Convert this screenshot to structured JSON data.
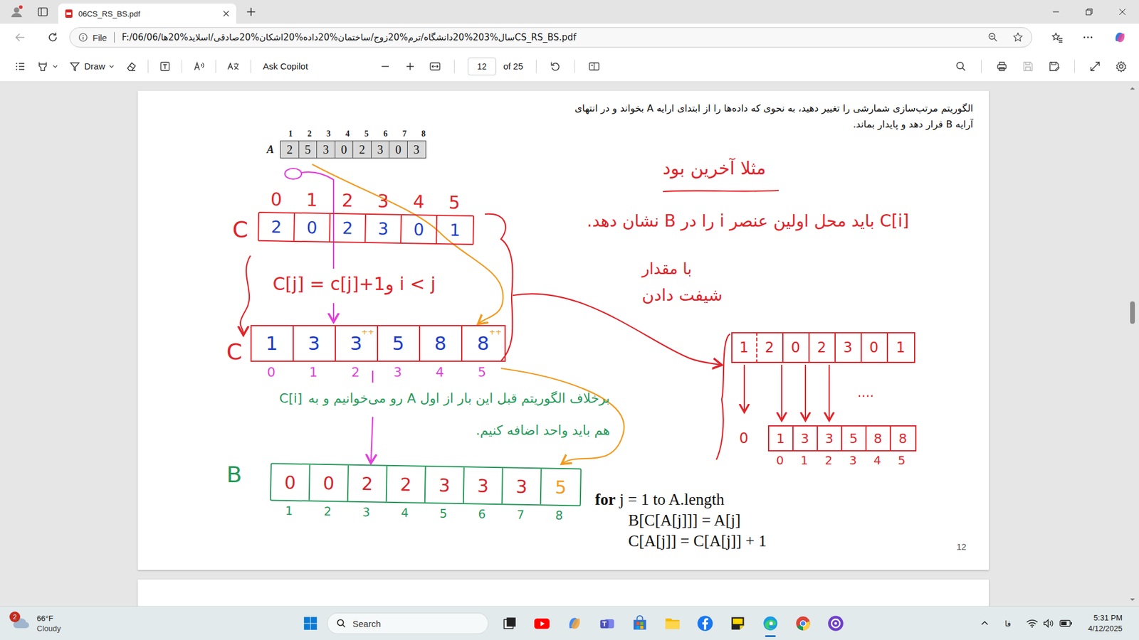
{
  "window": {
    "title": "06CS_RS_BS.pdf"
  },
  "tabs": [
    {
      "label": "06CS_RS_BS.pdf",
      "selected": true
    }
  ],
  "address": {
    "scheme": "File",
    "url": "F:/06/سال%203%20دانشگاه/ترم%20زوج/ساختمان%20داده%20اشکان%20صادقی/اسلاید%20ها/06CS_RS_BS.pdf"
  },
  "toolbar": {
    "draw": "Draw",
    "copilot": "Ask Copilot",
    "page": "12",
    "pages": "of 25"
  },
  "page": {
    "heading": [
      "الگوریتم مرتب‌سازی شمارشی را تغییر دهید، به نحوی که داده‌ها را از ابتدای ارایه A بخواند و در انتهای",
      "آرایه B قرار دهد و پایدار بماند."
    ],
    "arrayA": {
      "label": "A",
      "indices": [
        "1",
        "2",
        "3",
        "4",
        "5",
        "6",
        "7",
        "8"
      ],
      "values": [
        "2",
        "5",
        "3",
        "0",
        "2",
        "3",
        "0",
        "3"
      ]
    },
    "code": [
      {
        "keyword": "for",
        "text": "j  = 1 to A.length",
        "indent": false
      },
      {
        "text": "B[C[A[j]]] = A[j]",
        "indent": true
      },
      {
        "text": "C[A[j]] = C[A[j]] + 1",
        "indent": true
      }
    ],
    "number": "12"
  },
  "annotations": {
    "countArray": {
      "label": "C",
      "indices": [
        "0",
        "1",
        "2",
        "3",
        "4",
        "5"
      ],
      "values": [
        "2",
        "0",
        "2",
        "3",
        "0",
        "1"
      ]
    },
    "formula": "C[j] = c[j]+1و i < j",
    "positionArray": {
      "label": "C",
      "indices": [
        "0",
        "1",
        "2",
        "3",
        "4",
        "5"
      ],
      "values": [
        "1",
        "3",
        "3",
        "5",
        "8",
        "8"
      ],
      "marks": [
        "",
        "",
        "++",
        "",
        "",
        "++"
      ]
    },
    "outputArray": {
      "label": "B",
      "indices": [
        "1",
        "2",
        "3",
        "4",
        "5",
        "6",
        "7",
        "8"
      ],
      "values": [
        {
          "value": "0",
          "color": "#d8232a"
        },
        {
          "value": "0",
          "color": "#d8232a"
        },
        {
          "value": "2",
          "color": "#d8232a"
        },
        {
          "value": "2",
          "color": "#d8232a"
        },
        {
          "value": "3",
          "color": "#d8232a"
        },
        {
          "value": "3",
          "color": "#d8232a"
        },
        {
          "value": "3",
          "color": "#d8232a"
        },
        {
          "value": "5",
          "color": "#f29a1f"
        }
      ]
    },
    "greenNote": {
      "ref": "C[i]",
      "lines": [
        "برخلاف الگوریتم قبل این بار از اول A رو می‌خوانیم و به",
        "هم باید واحد اضافه کنیم."
      ]
    },
    "redNotes": {
      "example": "مثلا آخرین بود",
      "meaning": "C[i] باید محل اولین عنصر i را در B نشان دهد.",
      "amount": "با مقدار",
      "shift": "شیفت دادن"
    },
    "shiftBefore": {
      "values": [
        "1",
        "2",
        "0",
        "2",
        "3",
        "0",
        "1"
      ]
    },
    "shiftAfter": {
      "values": [
        "1",
        "3",
        "3",
        "5",
        "8",
        "8"
      ],
      "indices": [
        "0",
        "1",
        "2",
        "3",
        "4",
        "5"
      ]
    },
    "ellipsis": "....",
    "zero": "0"
  },
  "taskbar": {
    "weather": {
      "temp": "66°F",
      "condition": "Cloudy",
      "badge": "2"
    },
    "search": "Search",
    "language": "فا",
    "time": "5:31 PM",
    "date": "4/12/2025"
  }
}
